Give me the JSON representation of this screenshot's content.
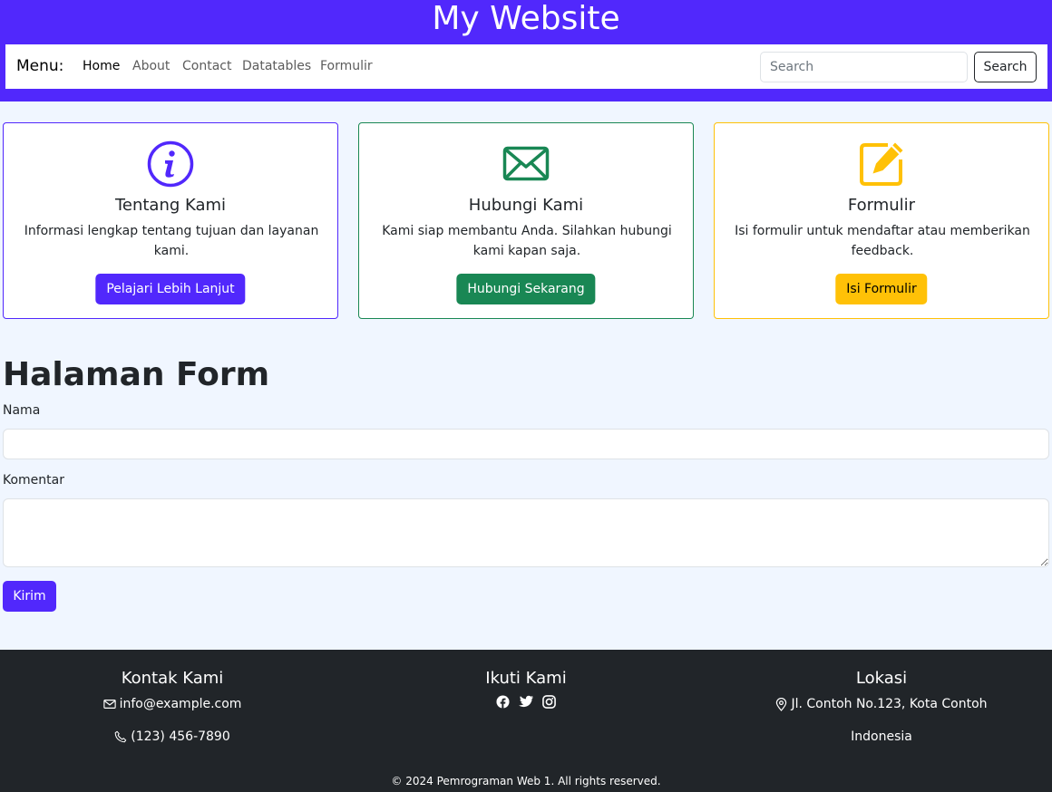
{
  "header": {
    "title": "My Website",
    "menu_label": "Menu:",
    "nav": [
      "Home",
      "About",
      "Contact",
      "Datatables",
      "Formulir"
    ],
    "search_placeholder": "Search",
    "search_button": "Search"
  },
  "cards": [
    {
      "title": "Tentang Kami",
      "text": "Informasi lengkap tentang tujuan dan layanan kami.",
      "button": "Pelajari Lebih Lanjut",
      "icon": "info-circle-icon",
      "color": "#5128fc"
    },
    {
      "title": "Hubungi Kami",
      "text": "Kami siap membantu Anda. Silahkan hubungi kami kapan saja.",
      "button": "Hubungi Sekarang",
      "icon": "envelope-icon",
      "color": "#198754"
    },
    {
      "title": "Formulir",
      "text": "Isi formulir untuk mendaftar atau memberikan feedback.",
      "button": "Isi Formulir",
      "icon": "edit-square-icon",
      "color": "#ffc107"
    }
  ],
  "form": {
    "heading": "Halaman Form",
    "name_label": "Nama",
    "comment_label": "Komentar",
    "submit": "Kirim"
  },
  "footer": {
    "contact_title": "Kontak Kami",
    "email": "info@example.com",
    "phone": "(123) 456-7890",
    "follow_title": "Ikuti Kami",
    "social_icons": [
      "facebook-icon",
      "twitter-icon",
      "instagram-icon"
    ],
    "location_title": "Lokasi",
    "address_line1": "Jl. Contoh No.123, Kota Contoh",
    "address_line2": "Indonesia",
    "copyright": "© 2024 Pemrograman Web 1. All rights reserved."
  }
}
